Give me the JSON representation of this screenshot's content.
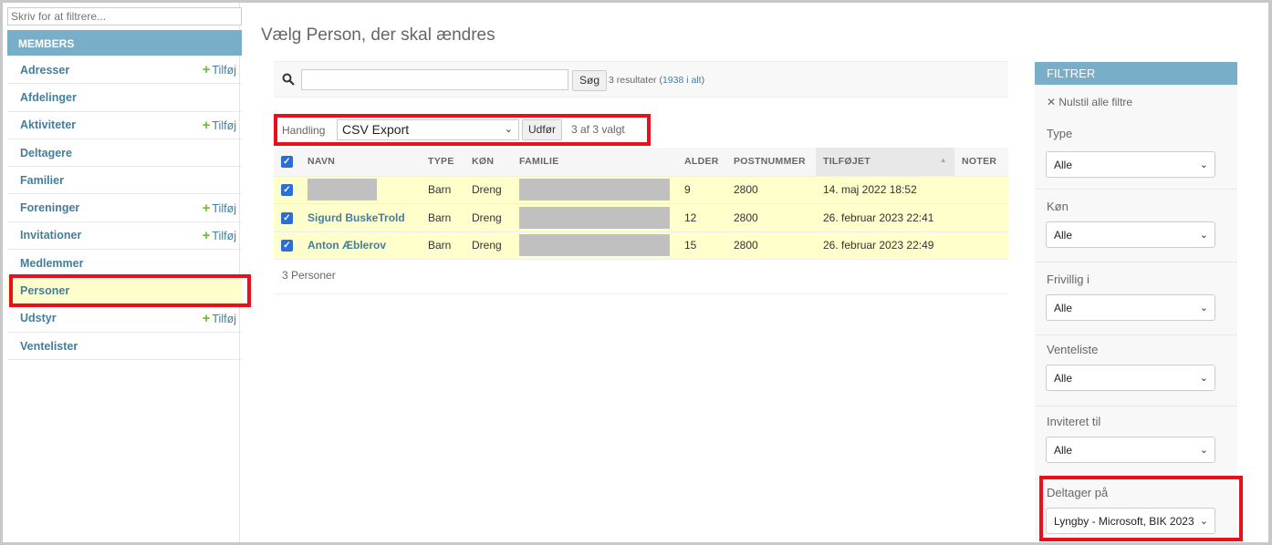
{
  "sidebar": {
    "filter_placeholder": "Skriv for at filtrere...",
    "section_title": "MEMBERS",
    "add_label": "Tilføj",
    "items": [
      {
        "label": "Adresser",
        "has_add": true
      },
      {
        "label": "Afdelinger",
        "has_add": false
      },
      {
        "label": "Aktiviteter",
        "has_add": true
      },
      {
        "label": "Deltagere",
        "has_add": false
      },
      {
        "label": "Familier",
        "has_add": false
      },
      {
        "label": "Foreninger",
        "has_add": true
      },
      {
        "label": "Invitationer",
        "has_add": true
      },
      {
        "label": "Medlemmer",
        "has_add": false
      },
      {
        "label": "Personer",
        "has_add": false,
        "active": true
      },
      {
        "label": "Udstyr",
        "has_add": true
      },
      {
        "label": "Ventelister",
        "has_add": false
      }
    ]
  },
  "main": {
    "title": "Vælg Person, der skal ændres",
    "search": {
      "button": "Søg",
      "results_prefix": "3 resultater (",
      "results_link": "1938 i alt",
      "results_suffix": ")"
    },
    "actions": {
      "label": "Handling",
      "selected_action": "CSV Export",
      "run_button": "Udfør",
      "selected_count": "3 af 3 valgt"
    },
    "table": {
      "headers": [
        "NAVN",
        "TYPE",
        "KØN",
        "FAMILIE",
        "ALDER",
        "POSTNUMMER",
        "TILFØJET",
        "NOTER"
      ],
      "rows": [
        {
          "name": "",
          "type": "Barn",
          "gender": "Dreng",
          "age": "9",
          "postal": "2800",
          "added": "14. maj 2022 18:52",
          "notes": ""
        },
        {
          "name": "Sigurd BuskeTrold",
          "type": "Barn",
          "gender": "Dreng",
          "age": "12",
          "postal": "2800",
          "added": "26. februar 2023 22:41",
          "notes": ""
        },
        {
          "name": "Anton Æblerov",
          "type": "Barn",
          "gender": "Dreng",
          "age": "15",
          "postal": "2800",
          "added": "26. februar 2023 22:49",
          "notes": ""
        }
      ],
      "footer": "3 Personer"
    }
  },
  "filters": {
    "header": "FILTRER",
    "clear": "Nulstil alle filtre",
    "groups": [
      {
        "title": "Type",
        "value": "Alle"
      },
      {
        "title": "Køn",
        "value": "Alle"
      },
      {
        "title": "Frivillig i",
        "value": "Alle"
      },
      {
        "title": "Venteliste",
        "value": "Alle"
      },
      {
        "title": "Inviteret til",
        "value": "Alle"
      },
      {
        "title": "Deltager på",
        "value": "Lyngby - Microsoft, BIK 2023"
      }
    ]
  },
  "colors": {
    "accent": "#79aec8",
    "link": "#447e9b",
    "selected_row": "#ffffcc",
    "highlight": "#e8101c",
    "add_plus": "#70bf2b"
  }
}
